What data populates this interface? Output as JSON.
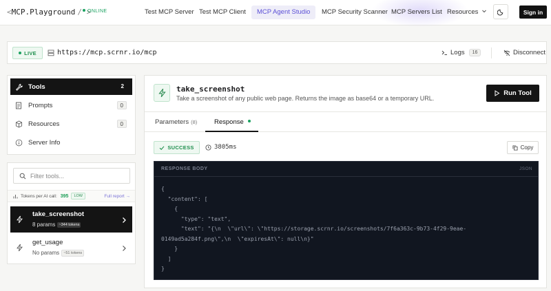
{
  "brand": {
    "prefix": "<",
    "name": "MCP",
    "suffix": ".Playground",
    "end": "/ >",
    "status": "ONLINE"
  },
  "nav": {
    "links": [
      "Test MCP Server",
      "Test MCP Client",
      "MCP Agent Studio",
      "MCP Security Scanner",
      "MCP Servers List",
      "Resources"
    ],
    "active": "MCP Agent Studio",
    "signin": "Sign in"
  },
  "connection": {
    "status": "LIVE",
    "url": "https://mcp.scrnr.io/mcp",
    "logs_label": "Logs",
    "logs_count": "16",
    "disconnect_label": "Disconnect"
  },
  "sidebar": {
    "items": [
      {
        "label": "Tools",
        "count": "2",
        "icon": "wrench-icon"
      },
      {
        "label": "Prompts",
        "count": "0",
        "icon": "document-icon"
      },
      {
        "label": "Resources",
        "count": "0",
        "icon": "box-icon"
      },
      {
        "label": "Server Info",
        "count": "",
        "icon": "info-icon"
      }
    ]
  },
  "tools_panel": {
    "filter_placeholder": "Filter tools...",
    "tokens_label": "Tokens per AI call:",
    "tokens_value": "395",
    "tokens_level": "LOW",
    "full_report": "Full report →",
    "tools": [
      {
        "name": "take_screenshot",
        "params": "8 params",
        "tokens": "~344 tokens"
      },
      {
        "name": "get_usage",
        "params": "No params",
        "tokens": "~51 tokens"
      }
    ]
  },
  "main": {
    "tool_name": "take_screenshot",
    "description": "Take a screenshot of any public web page. Returns the image as base64 or a temporary URL.",
    "run_label": "Run Tool",
    "tabs": [
      {
        "label": "Parameters",
        "sub": "(8)"
      },
      {
        "label": "Response",
        "sub": ""
      }
    ],
    "result_status": "SUCCESS",
    "duration": "3805ms",
    "copy_label": "Copy",
    "response_header": "RESPONSE BODY",
    "response_format": "JSON",
    "response_body": "{\n  \"content\": [\n    {\n      \"type\": \"text\",\n      \"text\": \"{\\n  \\\"url\\\": \\\"https://storage.scrnr.io/screenshots/7f6a363c-9b73-4f29-9eae-\n0149ad5a284f.png\\\",\\n  \\\"expiresAt\\\": null\\n}\"\n    }\n  ]\n}"
  }
}
